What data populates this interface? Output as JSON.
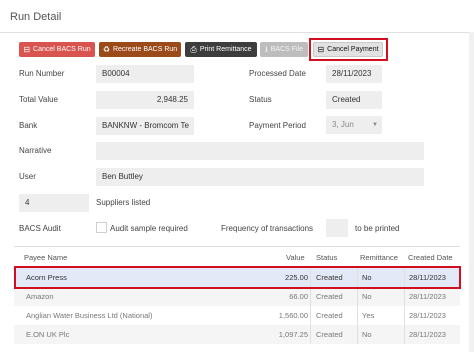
{
  "header": {
    "title": "Run Detail"
  },
  "toolbar": {
    "cancel_bacs_run": "Cancel BACS Run",
    "recreate_bacs_run": "Recreate BACS Run",
    "print_remittance": "Print Remittance",
    "bacs_file": "BACS File",
    "cancel_payment": "Cancel Payment"
  },
  "form": {
    "run_number_label": "Run Number",
    "run_number": "B00004",
    "processed_date_label": "Processed Date",
    "processed_date": "28/11/2023",
    "total_value_label": "Total Value",
    "total_value": "2,948.25",
    "status_label": "Status",
    "status": "Created",
    "bank_label": "Bank",
    "bank": "BANKNW - Bromcom Te",
    "payment_period_label": "Payment Period",
    "payment_period": "3, Jun",
    "narrative_label": "Narrative",
    "narrative": "",
    "user_label": "User",
    "user": "Ben Buttley",
    "suppliers_count": "4",
    "suppliers_label": "Suppliers listed",
    "bacs_audit_label": "BACS Audit",
    "audit_sample_label": "Audit sample required",
    "audit_sample_checked": false,
    "frequency_label": "Frequency of transactions",
    "frequency_value": "",
    "to_be_printed_label": "to be printed"
  },
  "table": {
    "headers": {
      "payee": "Payee Name",
      "value": "Value",
      "status": "Status",
      "remittance": "Remittance",
      "created": "Created Date"
    },
    "rows": [
      {
        "payee": "Acorn Press",
        "value": "225.00",
        "status": "Created",
        "remittance": "No",
        "created": "28/11/2023"
      },
      {
        "payee": "Amazon",
        "value": "66.00",
        "status": "Created",
        "remittance": "No",
        "created": "28/11/2023"
      },
      {
        "payee": "Anglian Water Business Ltd (National)",
        "value": "1,560.00",
        "status": "Created",
        "remittance": "Yes",
        "created": "28/11/2023"
      },
      {
        "payee": "E.ON UK Plc",
        "value": "1,097.25",
        "status": "Created",
        "remittance": "No",
        "created": "28/11/2023"
      }
    ],
    "selected_row": 0
  },
  "icons": {
    "cancel_run": "minus-square-icon",
    "recreate": "recycle-icon",
    "print": "printer-icon",
    "bacs_file": "download-icon",
    "cancel_payment": "minus-square-icon",
    "dropdown": "chevron-down-icon"
  },
  "colors": {
    "danger": "#d9534f",
    "recreate": "#9b4a1a",
    "dark": "#3d3d3d",
    "disabled": "#bdbdbd",
    "highlight": "#d0101e",
    "selected_row": "#e3e9f7"
  }
}
